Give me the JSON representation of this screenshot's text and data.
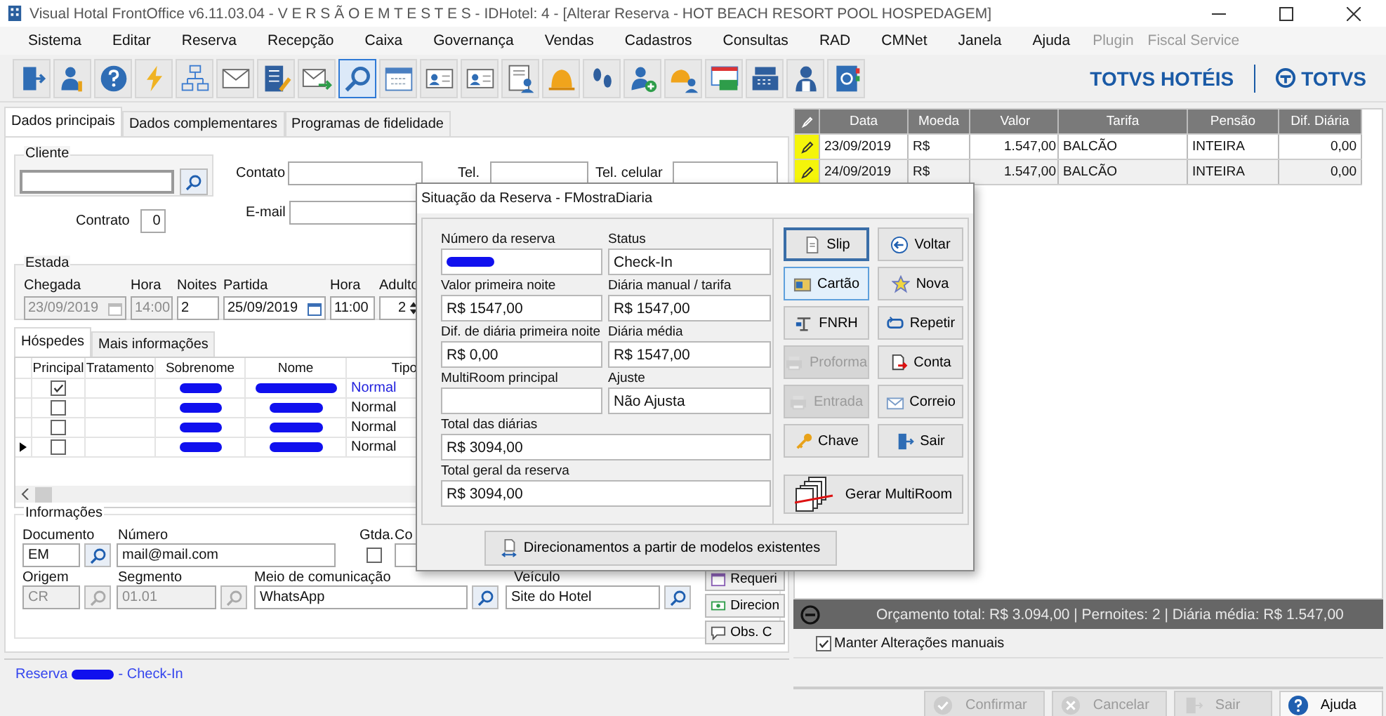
{
  "window": {
    "title": "Visual Hotal FrontOffice v6.11.03.04 - V E R S Ã O   E M   T E S T E S   - IDHotel: 4 - [Alterar Reserva - HOT BEACH RESORT POOL HOSPEDAGEM]"
  },
  "menu": [
    {
      "label": "Sistema",
      "disabled": false
    },
    {
      "label": "Editar",
      "disabled": false
    },
    {
      "label": "Reserva",
      "disabled": false
    },
    {
      "label": "Recepção",
      "disabled": false
    },
    {
      "label": "Caixa",
      "disabled": false
    },
    {
      "label": "Governança",
      "disabled": false
    },
    {
      "label": "Vendas",
      "disabled": false
    },
    {
      "label": "Cadastros",
      "disabled": false
    },
    {
      "label": "Consultas",
      "disabled": false
    },
    {
      "label": "RAD",
      "disabled": false
    },
    {
      "label": "CMNet",
      "disabled": false
    },
    {
      "label": "Janela",
      "disabled": false
    },
    {
      "label": "Ajuda",
      "disabled": false
    },
    {
      "label": "Plugin",
      "disabled": true
    },
    {
      "label": "Fiscal Service",
      "disabled": true
    }
  ],
  "toolbar": [
    {
      "kind": "exit",
      "selected": false
    },
    {
      "kind": "userkey",
      "selected": false
    },
    {
      "kind": "help",
      "selected": false
    },
    {
      "kind": "bolt",
      "selected": false
    },
    {
      "kind": "flow",
      "selected": false
    },
    {
      "kind": "mail",
      "selected": false
    },
    {
      "kind": "calc",
      "selected": false
    },
    {
      "kind": "mailsend",
      "selected": false
    },
    {
      "kind": "search",
      "selected": true
    },
    {
      "kind": "calendar",
      "selected": false
    },
    {
      "kind": "card",
      "selected": false
    },
    {
      "kind": "card",
      "selected": false
    },
    {
      "kind": "docperson",
      "selected": false
    },
    {
      "kind": "bell",
      "selected": false
    },
    {
      "kind": "feet",
      "selected": false
    },
    {
      "kind": "adduser",
      "selected": false
    },
    {
      "kind": "bellperson",
      "selected": false
    },
    {
      "kind": "money",
      "selected": false
    },
    {
      "kind": "register",
      "selected": false
    },
    {
      "kind": "person",
      "selected": false
    },
    {
      "kind": "book",
      "selected": false
    }
  ],
  "brand": {
    "product": "TOTVS HOTÉIS",
    "company": "TOTVS"
  },
  "tabs": [
    {
      "label": "Dados principais",
      "selected": true
    },
    {
      "label": "Dados complementares",
      "selected": false
    },
    {
      "label": "Programas de fidelidade",
      "selected": false
    }
  ],
  "cliente": {
    "title": "Cliente",
    "contrato_label": "Contrato",
    "contrato": "0"
  },
  "contact": {
    "contato": "Contato",
    "tel": "Tel.",
    "celular": "Tel. celular",
    "email": "E-mail"
  },
  "estada": {
    "title": "Estada",
    "fields": [
      {
        "label": "Chegada",
        "value": "23/09/2019",
        "kind": "date",
        "disabled": true
      },
      {
        "label": "Hora",
        "value": "14:00",
        "kind": "text",
        "disabled": true
      },
      {
        "label": "Noites",
        "value": "2",
        "kind": "text",
        "disabled": false
      },
      {
        "label": "Partida",
        "value": "25/09/2019",
        "kind": "date",
        "disabled": false
      },
      {
        "label": "Hora",
        "value": "11:00",
        "kind": "text",
        "disabled": false
      },
      {
        "label": "Adulto",
        "value": "2",
        "kind": "spin",
        "disabled": false
      }
    ]
  },
  "guest_tabs": [
    {
      "label": "Hóspedes",
      "selected": true
    },
    {
      "label": "Mais informações",
      "selected": false
    }
  ],
  "guests": {
    "columns": [
      "Principal",
      "Tratamento",
      "Sobrenome",
      "Nome",
      "Tipo"
    ],
    "rows": [
      {
        "principal": true,
        "selected": true,
        "current": false,
        "tipo": "Normal"
      },
      {
        "principal": false,
        "selected": false,
        "current": false,
        "tipo": "Normal"
      },
      {
        "principal": false,
        "selected": false,
        "current": false,
        "tipo": "Normal"
      },
      {
        "principal": false,
        "selected": false,
        "current": true,
        "tipo": "Normal"
      }
    ]
  },
  "info": {
    "title": "Informações",
    "documento_label": "Documento",
    "documento": "EM",
    "numero_label": "Número",
    "numero": "mail@mail.com",
    "gtda_label": "Gtda.",
    "gtda": false,
    "column_4_label": "Co",
    "origem_label": "Origem",
    "origem": "CR",
    "segmento_label": "Segmento",
    "segmento": "01.01",
    "meio_label": "Meio de comunicação",
    "meio": "WhatsApp",
    "veiculo_label": "Veículo",
    "veiculo": "Site do Hotel"
  },
  "side_buttons": [
    {
      "label": "Requeri",
      "kind": "calendar"
    },
    {
      "label": "Direcion",
      "kind": "money"
    },
    {
      "label": "Obs. C",
      "kind": "comment"
    }
  ],
  "status_line": {
    "prefix": "Reserva",
    "suffix": "- Check-In"
  },
  "rates": {
    "columns": [
      "Data",
      "Moeda",
      "Valor",
      "Tarifa",
      "Pensão",
      "Dif. Diária"
    ],
    "rows": [
      {
        "cells": [
          "23/09/2019",
          "R$",
          "1.547,00",
          "BALCÃO",
          "INTEIRA",
          "0,00"
        ]
      },
      {
        "cells": [
          "24/09/2019",
          "R$",
          "1.547,00",
          "BALCÃO",
          "INTEIRA",
          "0,00"
        ]
      }
    ]
  },
  "summary": "Orçamento total: R$ 3.094,00 | Pernoites: 2 | Diária média: R$ 1.547,00",
  "keep_manual": {
    "label": "Manter Alterações manuais",
    "checked": true
  },
  "bottom_buttons": [
    {
      "label": "Confirmar",
      "kind": "confirm",
      "disabled": true
    },
    {
      "label": "Cancelar",
      "kind": "cancel",
      "disabled": true
    },
    {
      "label": "Sair",
      "kind": "exit",
      "disabled": true
    },
    {
      "label": "Ajuda",
      "kind": "help",
      "disabled": false
    }
  ],
  "dialog": {
    "title": "Situação da Reserva - FMostraDiaria",
    "fields": [
      {
        "label": "Número da reserva",
        "kind": "half",
        "redacted": true
      },
      {
        "label": "Status",
        "value": "Check-In",
        "kind": "half"
      },
      {
        "label": "Valor primeira noite",
        "value": "R$ 1547,00",
        "kind": "half"
      },
      {
        "label": "Diária manual / tarifa",
        "value": "R$ 1547,00",
        "kind": "half"
      },
      {
        "label": "Dif. de diária primeira noite",
        "value": "R$ 0,00",
        "kind": "half"
      },
      {
        "label": "Diária média",
        "value": "R$ 1547,00",
        "kind": "half"
      },
      {
        "label": "MultiRoom principal",
        "kind": "half"
      },
      {
        "label": "Ajuste",
        "value": "Não Ajusta",
        "kind": "half"
      },
      {
        "label": "Total das diárias",
        "value": "R$ 3094,00",
        "kind": "full"
      },
      {
        "label": "Total geral da reserva",
        "value": "R$ 3094,00",
        "kind": "full"
      }
    ],
    "buttons": [
      {
        "label": "Slip",
        "kind": "slip",
        "focused": true,
        "hot": false,
        "disabled": false
      },
      {
        "label": "Voltar",
        "kind": "back",
        "focused": false,
        "hot": false,
        "disabled": false
      },
      {
        "label": "Cartão",
        "kind": "card",
        "focused": false,
        "hot": true,
        "disabled": false
      },
      {
        "label": "Nova",
        "kind": "new",
        "focused": false,
        "hot": false,
        "disabled": false
      },
      {
        "label": "FNRH",
        "kind": "form",
        "focused": false,
        "hot": false,
        "disabled": false
      },
      {
        "label": "Repetir",
        "kind": "repeat",
        "focused": false,
        "hot": false,
        "disabled": false
      },
      {
        "label": "Proforma",
        "kind": "print",
        "focused": false,
        "hot": false,
        "disabled": true
      },
      {
        "label": "Conta",
        "kind": "account",
        "focused": false,
        "hot": false,
        "disabled": false
      },
      {
        "label": "Entrada",
        "kind": "print",
        "focused": false,
        "hot": false,
        "disabled": true
      },
      {
        "label": "Correio",
        "kind": "mail",
        "focused": false,
        "hot": false,
        "disabled": false
      },
      {
        "label": "Chave",
        "kind": "key",
        "focused": false,
        "hot": false,
        "disabled": false
      },
      {
        "label": "Sair",
        "kind": "exit",
        "focused": false,
        "hot": false,
        "disabled": false
      }
    ],
    "wide_button": {
      "label": "Gerar MultiRoom",
      "kind": "multiroom"
    },
    "footer_button": {
      "label": "Direcionamentos a partir de modelos existentes",
      "kind": "redirect"
    }
  }
}
